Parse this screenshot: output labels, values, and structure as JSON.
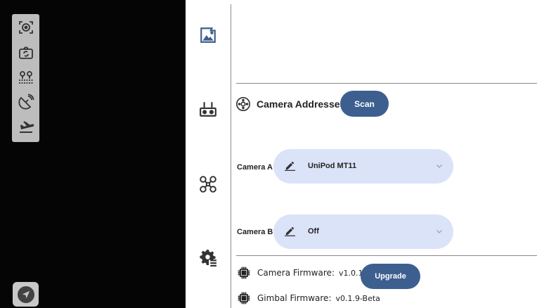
{
  "toolbar": {
    "icons": [
      "target-icon",
      "camera-rotate-icon",
      "waypoint-icon",
      "satellite-dish-icon",
      "flight-land-icon"
    ]
  },
  "nav": {
    "items": [
      "photo-settings-icon",
      "remote-controller-icon",
      "drone-icon",
      "gear-settings-icon"
    ]
  },
  "camera_section": {
    "title": "Camera Addresses",
    "scan_label": "Scan"
  },
  "cameras": [
    {
      "label": "Camera A",
      "value": "UniPod MT11"
    },
    {
      "label": "Camera B",
      "value": "Off"
    }
  ],
  "firmware": {
    "camera_label": "Camera Firmware:",
    "camera_version": "v1.0.1",
    "upgrade_label": "Upgrade",
    "gimbal_label": "Gimbal Firmware:",
    "gimbal_version": "v0.1.9-Beta"
  },
  "colors": {
    "accent": "#3d5f8f",
    "select_bg": "#dbe3f9",
    "camera_bg": "#050505"
  }
}
